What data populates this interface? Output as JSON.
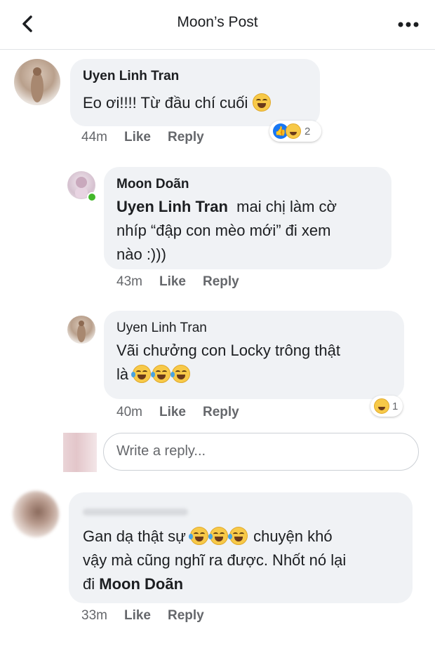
{
  "header": {
    "title": "Moon’s Post",
    "back_icon": "chevron-left-icon",
    "more_icon": "more-horizontal-icon"
  },
  "comments": [
    {
      "author": "Uyen Linh Tran",
      "text": "Eo ơi!!!! Từ đầu chí cuối",
      "time": "44m",
      "like": "Like",
      "reply": "Reply",
      "reaction_count": "2"
    },
    {
      "author": "Moon Doãn",
      "mention": "Uyen Linh Tran",
      "text_line1": "mai chị làm cờ",
      "text_line2": "nhíp “đập con mèo mới” đi xem",
      "text_line3": "nào :)))",
      "time": "43m",
      "like": "Like",
      "reply": "Reply"
    },
    {
      "author": "Uyen Linh Tran",
      "text_line1": "Vãi chưởng con Locky trông thật",
      "text_line2": "là",
      "time": "40m",
      "like": "Like",
      "reply": "Reply",
      "reaction_count": "1"
    },
    {
      "text_line1_a": "Gan dạ thật sự",
      "text_line1_b": "chuyện khó",
      "text_line2": "vậy mà cũng nghĩ ra được. Nhốt nó lại",
      "text_line3_a": "đi",
      "mention": "Moon Doãn",
      "time": "33m",
      "like": "Like",
      "reply": "Reply"
    }
  ],
  "reply_box": {
    "placeholder": "Write a reply..."
  },
  "colors": {
    "bubble": "#f0f2f5",
    "meta": "#65676b",
    "like_blue": "#1877f2",
    "online_green": "#42b72a"
  }
}
